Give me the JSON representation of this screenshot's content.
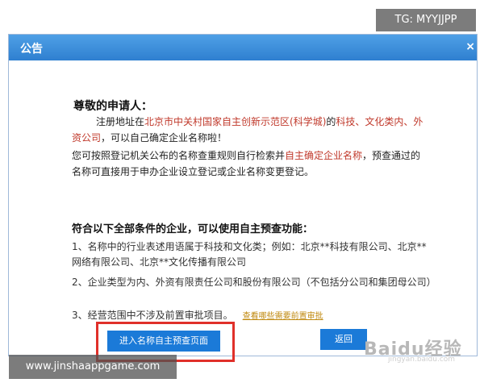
{
  "dialog": {
    "title": "公告",
    "close_glyph": "×",
    "greeting": "尊敬的申请人：",
    "para1": {
      "part1": "注册地址在",
      "part2_red": "北京市中关村国家自主创新示范区(科学城)",
      "part3": "的",
      "part4_red": "科技、文化类内、外资公司",
      "part5": "，可以自己确定企业名称啦！"
    },
    "para2": {
      "part1": "您可按照登记机关公布的名称查重规则自行检索并",
      "part2_red": "自主确定企业名称",
      "part3": "，预查通过的名称可直接用于申办企业设立登记或企业名称变更登记。"
    },
    "section_title": "符合以下全部条件的企业，可以使用自主预查功能：",
    "conditions": [
      "1、名称中的行业表述用语属于科技和文化类；例如：北京**科技有限公司、北京**网络有限公司、北京**文化传播有限公司",
      "2、企业类型为内、外资有限责任公司和股份有限公司（不包括分公司和集团母公司）",
      "3、经营范围中不涉及前置审批项目。"
    ],
    "condition3_link": "查看哪些需要前置审批",
    "buttons": {
      "enter": "进入名称自主预查页面",
      "back": "返回"
    }
  },
  "watermark": {
    "logo": "Baidu经验",
    "sub": "jingyan.baidu.com"
  },
  "overlay": {
    "top_tag": "TG: MYYJJPP",
    "bottom_tag": "www.jinshaappgame.com"
  },
  "colors": {
    "titlebar": "#2f7fd0",
    "button": "#1b7ad8",
    "highlight": "#e0302a",
    "red_text": "#c0392b"
  }
}
